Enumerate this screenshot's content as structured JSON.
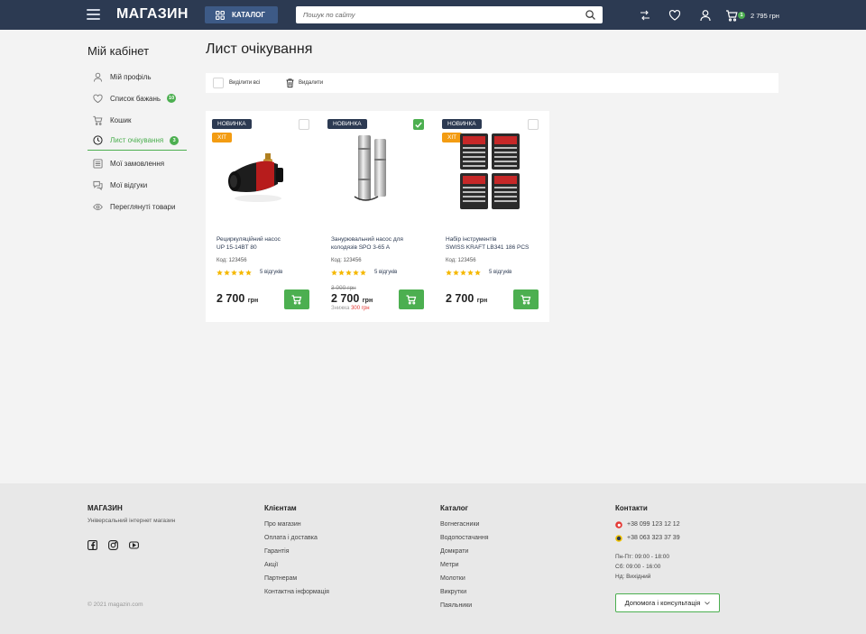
{
  "header": {
    "logo": "МАГАЗИН",
    "catalog_label": "КАТАЛОГ",
    "search_placeholder": "Пошук по сайту",
    "cart_count": "1",
    "cart_total": "2 795 грн"
  },
  "sidebar": {
    "title": "Мій кабінет",
    "items": [
      {
        "label": "Мій профіль",
        "icon": "user-icon"
      },
      {
        "label": "Список бажань",
        "icon": "heart-icon",
        "badge": "10"
      },
      {
        "label": "Кошик",
        "icon": "cart-icon"
      },
      {
        "label": "Лист очікування",
        "icon": "clock-icon",
        "badge": "3",
        "active": true
      },
      {
        "label": "Мої замовлення",
        "icon": "orders-icon"
      },
      {
        "label": "Мої відгуки",
        "icon": "reviews-icon"
      },
      {
        "label": "Переглянуті товари",
        "icon": "eye-icon"
      }
    ]
  },
  "main": {
    "title": "Лист очікування",
    "select_all": "Виділити всі",
    "delete": "Видалити"
  },
  "products": [
    {
      "badges": [
        "НОВИНКА",
        "ХІТ"
      ],
      "checked": false,
      "name_line1": "Рециркуляційний насос",
      "name_line2": "UP 15-14BT 80",
      "code": "Код: 123456",
      "rating": 5,
      "reviews": "5 відгуків",
      "old_price": "",
      "price": "2 700",
      "currency": "грн",
      "discount_label": "",
      "discount_value": ""
    },
    {
      "badges": [
        "НОВИНКА"
      ],
      "checked": true,
      "name_line1": "Занурювальний насос для",
      "name_line2": "колодязів SPO 3-65 A",
      "code": "Код: 123456",
      "rating": 5,
      "reviews": "5 відгуків",
      "old_price": "3 000 грн",
      "price": "2 700",
      "currency": "грн",
      "discount_label": "Знижка",
      "discount_value": "300 грн"
    },
    {
      "badges": [
        "НОВИНКА",
        "ХІТ"
      ],
      "checked": false,
      "name_line1": "Набір інструментів",
      "name_line2": "SWISS KRAFT LB341 186 PCS",
      "code": "Код: 123456",
      "rating": 5,
      "reviews": "5 відгуків",
      "old_price": "",
      "price": "2 700",
      "currency": "грн",
      "discount_label": "",
      "discount_value": ""
    }
  ],
  "footer": {
    "brand": "МАГАЗИН",
    "tagline": "Універсальний інтернет магазин",
    "copyright": "© 2021 magazin.com",
    "clients_title": "Клієнтам",
    "clients_links": [
      "Про магазин",
      "Оплата і доставка",
      "Гарантія",
      "Акції",
      "Партнерам",
      "Контактна інформація"
    ],
    "catalog_title": "Каталог",
    "catalog_links": [
      "Вогнегасники",
      "Водопостачання",
      "Домкрати",
      "Метри",
      "Молотки",
      "Викрутки",
      "Паяльники"
    ],
    "contacts_title": "Контакти",
    "phone1": "+38 099 123 12 12",
    "phone2": "+38 063 323 37 39",
    "hours1": "Пн-Пт: 09:00 - 18:00",
    "hours2": "Сб: 09:00 - 16:00",
    "hours3": "Нд: Вихідний",
    "help_button": "Допомога і консультація"
  },
  "colors": {
    "header": "#2c3a52",
    "accent": "#4caf50",
    "hit": "#f39c12",
    "sale": "#e53935"
  }
}
